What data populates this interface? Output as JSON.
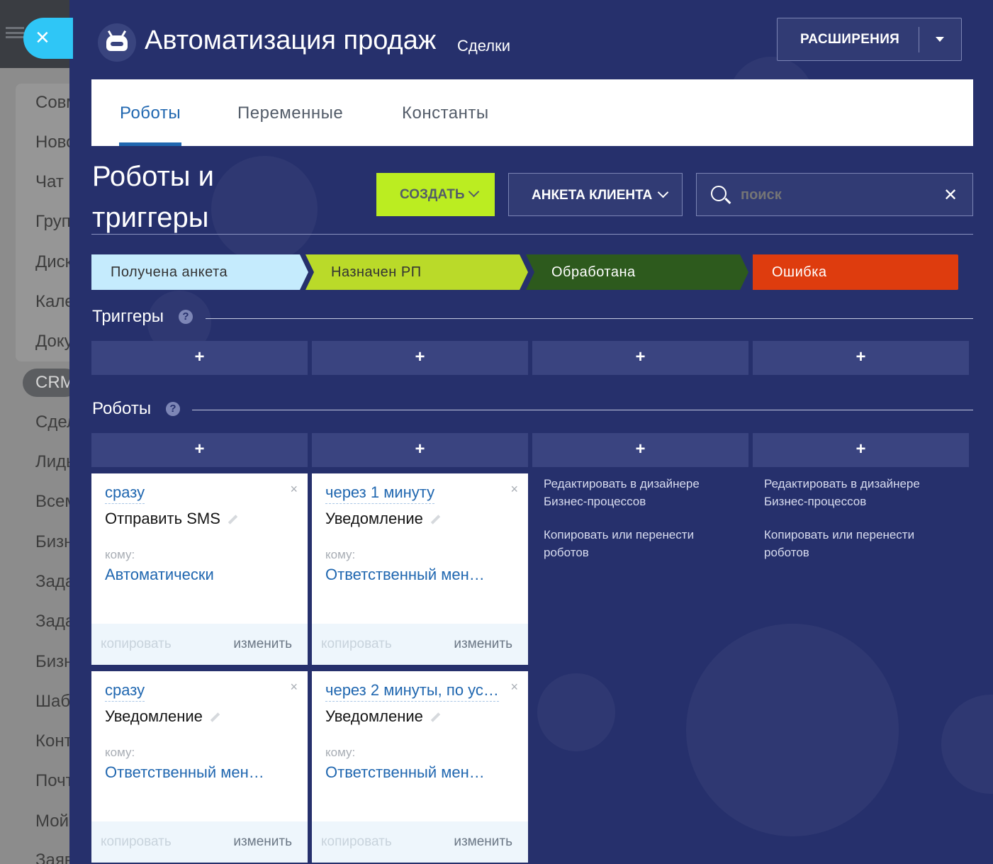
{
  "background_app": {
    "menu_items": [
      "Совм",
      "Ново",
      "Чат",
      "Груп",
      "Диск",
      "Кале",
      "Доку"
    ],
    "crm_label": "CRM",
    "crm_items": [
      "Сдел",
      "Лиды",
      "Всем",
      "Бизн",
      "Зада",
      "Зада",
      "Бизн",
      "Шаб",
      "Конт",
      "Почт",
      "Мой",
      "Заяв"
    ]
  },
  "header": {
    "title": "Автоматизация продаж",
    "subtitle": "Сделки",
    "extensions_button": "РАСШИРЕНИЯ"
  },
  "tabs": [
    {
      "label": "Роботы",
      "active": true
    },
    {
      "label": "Переменные",
      "active": false
    },
    {
      "label": "Константы",
      "active": false
    }
  ],
  "section": {
    "title_line1": "Роботы и",
    "title_line2": "триггеры"
  },
  "toolbar": {
    "create_label": "СОЗДАТЬ",
    "form_label": "АНКЕТА КЛИЕНТА",
    "search_placeholder": "поиск"
  },
  "stages": [
    {
      "label": "Получена анкета",
      "color": "#c5ebfd",
      "text_color": "#333333"
    },
    {
      "label": "Назначен РП",
      "color": "#bada29",
      "text_color": "#333333"
    },
    {
      "label": "Обработана",
      "color": "#2d5a1d",
      "text_color": "#ffffff"
    },
    {
      "label": "Ошибка",
      "color": "#de3c0e",
      "text_color": "#ffffff"
    }
  ],
  "triggers": {
    "title": "Триггеры",
    "help": "?",
    "add": "+"
  },
  "robots": {
    "title": "Роботы",
    "help": "?",
    "add": "+",
    "cards": [
      {
        "when": "сразу",
        "name": "Отправить SMS",
        "to_label": "кому:",
        "to_value": "Автоматически",
        "copy": "копировать",
        "edit": "изменить",
        "close": "×"
      },
      {
        "when": "через 1 минуту",
        "name": "Уведомление",
        "to_label": "кому:",
        "to_value": "Ответственный мен…",
        "copy": "копировать",
        "edit": "изменить",
        "close": "×"
      },
      {
        "when": "сразу",
        "name": "Уведомление",
        "to_label": "кому:",
        "to_value": "Ответственный мен…",
        "copy": "копировать",
        "edit": "изменить",
        "close": "×"
      },
      {
        "when": "через 2 минуты, по ус…",
        "name": "Уведомление",
        "to_label": "кому:",
        "to_value": "Ответственный мен…",
        "copy": "копировать",
        "edit": "изменить",
        "close": "×"
      }
    ],
    "empty_links": {
      "designer": "Редактировать в дизайнере Бизнес-процессов",
      "copy_move": "Копировать или перенести роботов"
    }
  },
  "colors": {
    "panel_bg": "#26306c",
    "accent": "#bbed21",
    "link": "#2067b0"
  }
}
